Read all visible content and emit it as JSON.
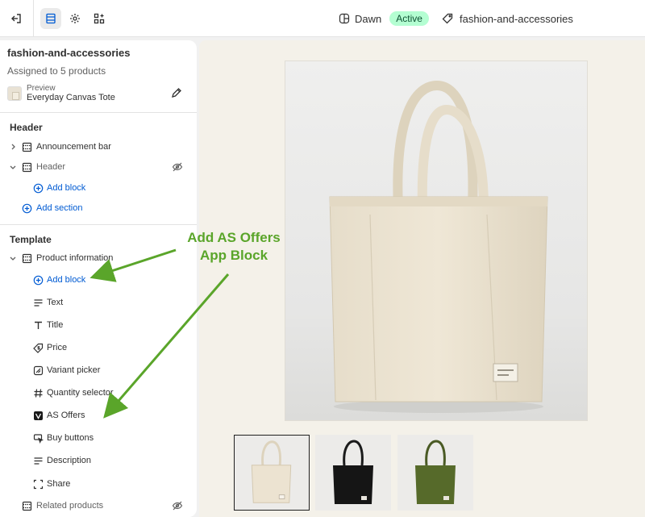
{
  "topbar": {
    "exit_icon": "exit-icon",
    "sections_icon": "sections-icon",
    "settings_icon": "gear-icon",
    "apps_icon": "apps-icon",
    "theme_name": "Dawn",
    "theme_status": "Active",
    "template_name": "fashion-and-accessories"
  },
  "sidebar": {
    "title": "fashion-and-accessories",
    "assigned": "Assigned to 5 products",
    "preview_label": "Preview",
    "preview_product": "Everyday Canvas Tote",
    "header_group": {
      "title": "Header",
      "items": [
        {
          "label": "Announcement bar",
          "icon": "section-icon",
          "expanded": false
        },
        {
          "label": "Header",
          "icon": "section-icon",
          "expanded": true,
          "hidden": true
        }
      ],
      "add_block": "Add block",
      "add_section": "Add section"
    },
    "template_group": {
      "title": "Template",
      "section": "Product information",
      "add_block": "Add block",
      "blocks": [
        {
          "label": "Text",
          "icon": "text-icon"
        },
        {
          "label": "Title",
          "icon": "title-icon"
        },
        {
          "label": "Price",
          "icon": "price-tag-icon"
        },
        {
          "label": "Variant picker",
          "icon": "variant-icon"
        },
        {
          "label": "Quantity selector",
          "icon": "hash-icon"
        },
        {
          "label": "AS Offers",
          "icon": "app-block-icon"
        },
        {
          "label": "Buy buttons",
          "icon": "cursor-click-icon"
        },
        {
          "label": "Description",
          "icon": "text-icon"
        },
        {
          "label": "Share",
          "icon": "share-frame-icon"
        }
      ],
      "related": "Related products"
    }
  },
  "annotation": {
    "line1": "Add AS Offers",
    "line2": "App Block",
    "color": "#5aa52a"
  },
  "preview": {
    "thumbnails": [
      {
        "color": "natural",
        "selected": true
      },
      {
        "color": "black",
        "selected": false
      },
      {
        "color": "olive",
        "selected": false
      }
    ]
  },
  "colors": {
    "link": "#005bd3",
    "active_badge_bg": "#b4fed2",
    "preview_bg": "#f4f1e9"
  }
}
